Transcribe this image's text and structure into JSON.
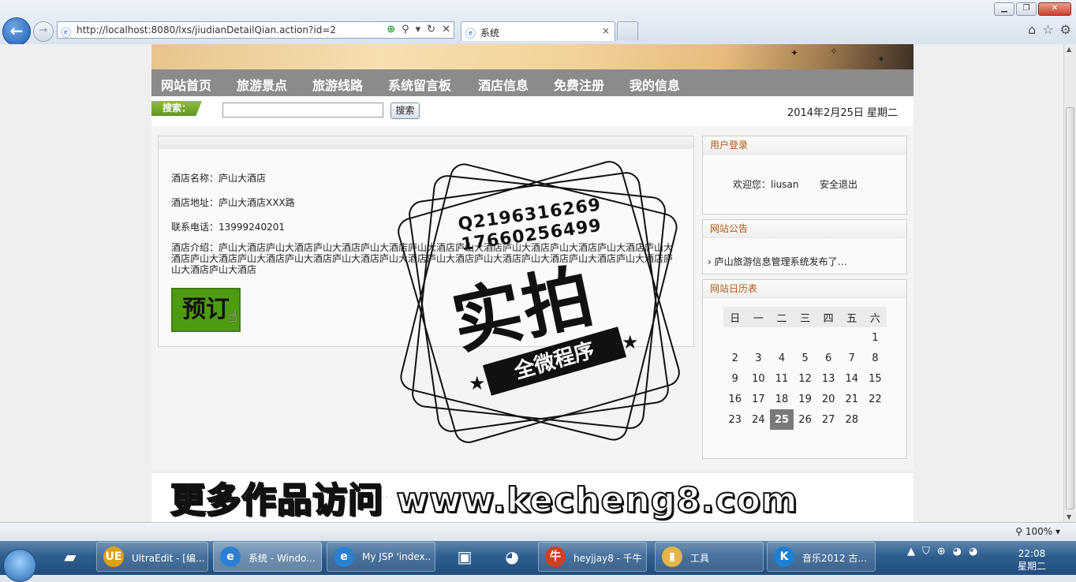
{
  "browser": {
    "url": "http://localhost:8080/lxs/jiudianDetailQian.action?id=2",
    "tab_title": "系统",
    "tab_close": "×",
    "win_minimize": "▁",
    "win_restore": "❐",
    "win_close": "✕",
    "zoom": "100%"
  },
  "site": {
    "menu": [
      "网站首页",
      "旅游景点",
      "旅游线路",
      "系统留言板",
      "酒店信息",
      "免费注册",
      "我的信息"
    ],
    "search_label": "搜索：",
    "search_button": "搜索",
    "date": "2014年2月25日  星期二"
  },
  "hotel": {
    "name_line": "酒店名称：庐山大酒店",
    "address_line": "酒店地址：庐山大酒店XXX路",
    "phone_line": "联系电话：13999240201",
    "intro_line": "酒店介绍：庐山大酒店庐山大酒店庐山大酒店庐山大酒店庐山大酒店庐山大酒店庐山大酒店庐山大酒店庐山大酒店庐山大酒店庐山大酒店庐山大酒店庐山大酒店庐山大酒店庐山大酒店庐山大酒店庐山大酒店庐山大酒店庐山大酒店庐山大酒店庐山大酒店庐山大酒店",
    "book_button": "预订"
  },
  "sidebar": {
    "login": {
      "title": "用户登录",
      "welcome": "欢迎您：liusan",
      "logout": "安全退出"
    },
    "notice": {
      "title": "网站公告",
      "item": "庐山旅游信息管理系统发布了…"
    },
    "calendar": {
      "title": "网站日历表",
      "weekdays": [
        "日",
        "一",
        "二",
        "三",
        "四",
        "五",
        "六"
      ],
      "weeks": [
        [
          "",
          "",
          "",
          "",
          "",
          "",
          "1"
        ],
        [
          "2",
          "3",
          "4",
          "5",
          "6",
          "7",
          "8"
        ],
        [
          "9",
          "10",
          "11",
          "12",
          "13",
          "14",
          "15"
        ],
        [
          "16",
          "17",
          "18",
          "19",
          "20",
          "21",
          "22"
        ],
        [
          "23",
          "24",
          "25",
          "26",
          "27",
          "28",
          ""
        ]
      ],
      "today": "25"
    }
  },
  "watermark": {
    "qq_line1": "Q2196316269",
    "qq_line2": "17660256499",
    "big_text": "实拍",
    "ribbon_text": "全微程序",
    "promo": "更多作品访问 www.kecheng8.com"
  },
  "taskbar": {
    "items": [
      {
        "label": "UltraEdit - [编...",
        "icon": "UE",
        "color": "#e0a010"
      },
      {
        "label": "系统 - Windo...",
        "icon": "e",
        "color": "#2b80d0"
      },
      {
        "label": "My JSP 'index...",
        "icon": "e",
        "color": "#2b80d0"
      },
      {
        "label": "heyjjay8 - 千牛",
        "icon": "牛",
        "color": "#d04020"
      },
      {
        "label": "工具",
        "icon": "▮",
        "color": "#e3b64a"
      },
      {
        "label": "音乐2012 古...",
        "icon": "K",
        "color": "#1f7fd0"
      }
    ],
    "clock": "22:08",
    "weekday": "星期二"
  }
}
